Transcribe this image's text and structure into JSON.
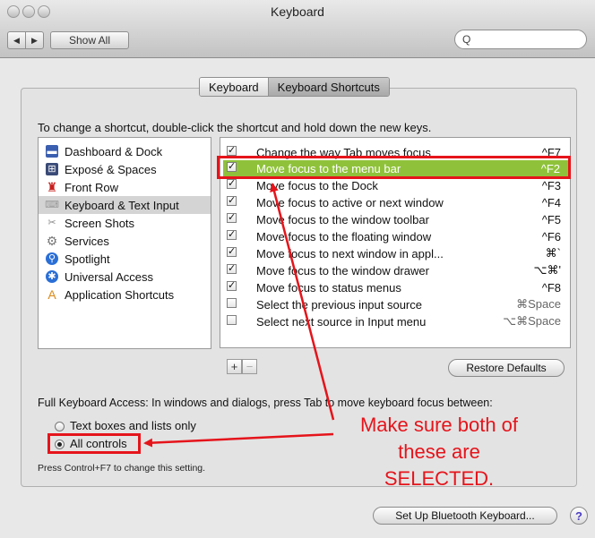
{
  "window": {
    "title": "Keyboard"
  },
  "toolbar": {
    "back": "◀",
    "forward": "▶",
    "show_all": "Show All",
    "search_icon": "Q"
  },
  "tabs": [
    {
      "label": "Keyboard"
    },
    {
      "label": "Keyboard Shortcuts",
      "selected": true
    }
  ],
  "instructions": "To change a shortcut, double-click the shortcut and hold down the new keys.",
  "categories": [
    {
      "label": "Dashboard & Dock",
      "icon": "dashboard-icon"
    },
    {
      "label": "Exposé & Spaces",
      "icon": "expose-icon"
    },
    {
      "label": "Front Row",
      "icon": "front-row-icon"
    },
    {
      "label": "Keyboard & Text Input",
      "icon": "keyboard-icon",
      "selected": true
    },
    {
      "label": "Screen Shots",
      "icon": "screenshot-icon"
    },
    {
      "label": "Services",
      "icon": "gear-icon"
    },
    {
      "label": "Spotlight",
      "icon": "spotlight-icon"
    },
    {
      "label": "Universal Access",
      "icon": "accessibility-icon"
    },
    {
      "label": "Application Shortcuts",
      "icon": "application-icon"
    }
  ],
  "shortcuts": [
    {
      "label": "Change the way Tab moves focus",
      "key": "^F7",
      "checked": true
    },
    {
      "label": "Move focus to the menu bar",
      "key": "^F2",
      "checked": true,
      "highlighted": true
    },
    {
      "label": "Move focus to the Dock",
      "key": "^F3",
      "checked": true
    },
    {
      "label": "Move focus to active or next window",
      "key": "^F4",
      "checked": true
    },
    {
      "label": "Move focus to the window toolbar",
      "key": "^F5",
      "checked": true
    },
    {
      "label": "Move focus to the floating window",
      "key": "^F6",
      "checked": true
    },
    {
      "label": "Move focus to next window in appl...",
      "key": "⌘`",
      "checked": true
    },
    {
      "label": "Move focus to the window drawer",
      "key": "⌥⌘'",
      "checked": true
    },
    {
      "label": "Move focus to status menus",
      "key": "^F8",
      "checked": true
    },
    {
      "label": "Select the previous input source",
      "key": "⌘Space",
      "checked": false
    },
    {
      "label": "Select next source in Input menu",
      "key": "⌥⌘Space",
      "checked": false
    }
  ],
  "buttons": {
    "add": "+",
    "remove": "−",
    "restore_defaults": "Restore Defaults",
    "bluetooth": "Set Up Bluetooth Keyboard...",
    "help": "?"
  },
  "full_keyboard_access": {
    "label": "Full Keyboard Access: In windows and dialogs, press Tab to move keyboard focus between:",
    "options": [
      {
        "label": "Text boxes and lists only",
        "selected": false
      },
      {
        "label": "All controls",
        "selected": true
      }
    ],
    "note": "Press Control+F7 to change this setting."
  },
  "annotation": {
    "line1": "Make sure both of",
    "line2": "these are",
    "line3": "SELECTED."
  },
  "colors": {
    "highlight": "#8fc23a",
    "annotation_red": "#e5141b"
  }
}
